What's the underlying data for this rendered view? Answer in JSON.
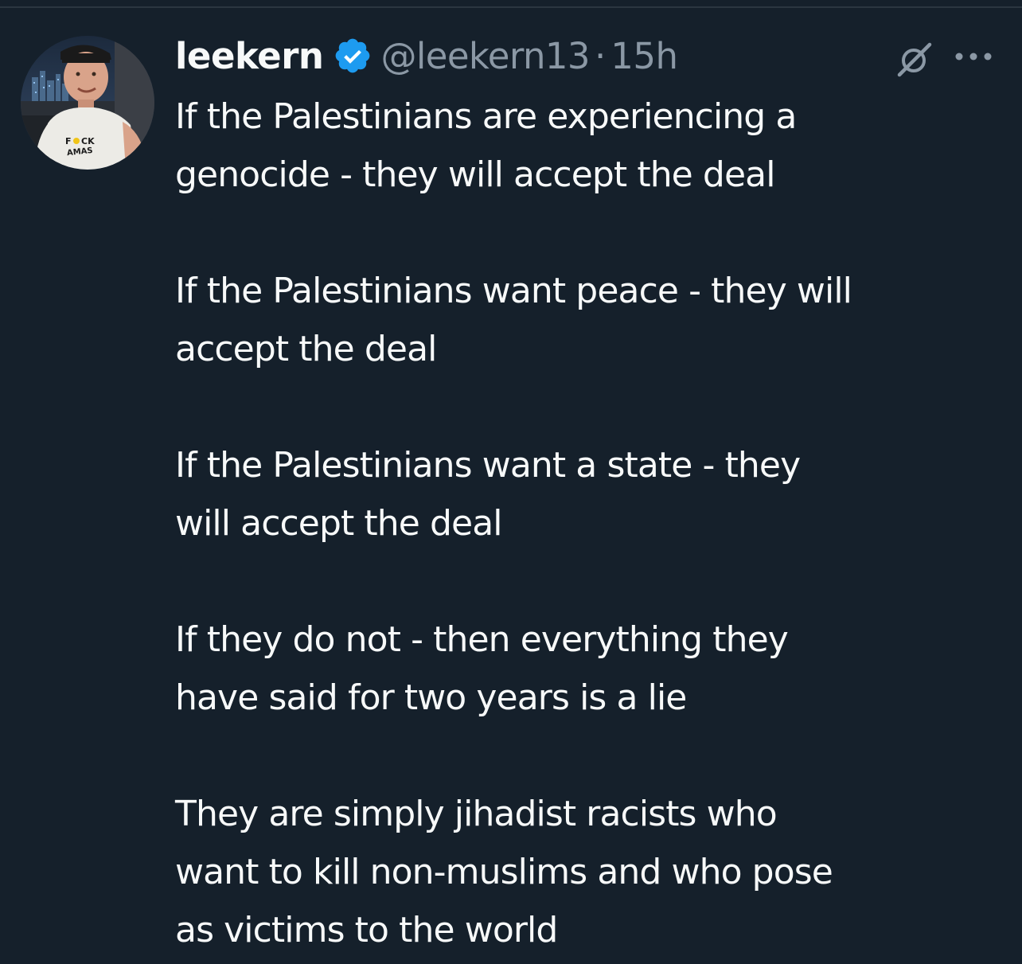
{
  "tweet": {
    "author": {
      "display_name": "leekern",
      "handle": "@leekern13",
      "verified_icon": "verified-badge-icon",
      "avatar_shirt_text": [
        "F",
        "CK",
        "AMAS"
      ]
    },
    "separator": "·",
    "timestamp": "15h",
    "actions": {
      "grok_icon": "grok-icon",
      "more_icon": "more-horizontal-icon"
    },
    "paragraphs": [
      {
        "lines": [
          "If the Palestinians are experiencing a",
          "genocide - they will accept the deal"
        ]
      },
      {
        "lines": [
          "If the Palestinians want peace - they will",
          "accept the deal"
        ]
      },
      {
        "lines": [
          "If the Palestinians want a state - they",
          "will accept the deal"
        ]
      },
      {
        "lines": [
          "If they do not - then everything they",
          "have said for two years is a lie"
        ]
      },
      {
        "lines": [
          "They are simply jihadist racists who",
          "want to kill non-muslims and who pose",
          "as victims to the world"
        ]
      }
    ]
  },
  "colors": {
    "background": "#15202b",
    "text_primary": "#f7f9f9",
    "text_secondary": "#8b98a5",
    "verified_blue": "#1d9bf0"
  }
}
